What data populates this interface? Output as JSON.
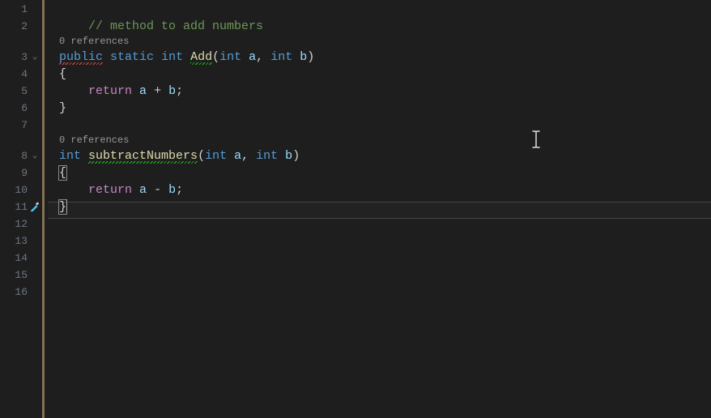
{
  "gutter": {
    "lines": [
      "1",
      "2",
      "3",
      "4",
      "5",
      "6",
      "7",
      "8",
      "9",
      "10",
      "11",
      "12",
      "13",
      "14",
      "15",
      "16"
    ]
  },
  "codelens": {
    "ref1": "0 references",
    "ref2": "0 references"
  },
  "code": {
    "l2_comment": "// method to add numbers",
    "l3_public": "public",
    "l3_static": "static",
    "l3_int": "int",
    "l3_method": "Add",
    "l3_p1t": "int",
    "l3_p1n": "a",
    "l3_p2t": "int",
    "l3_p2n": "b",
    "l4_brace": "{",
    "l5_return": "return",
    "l5_a": "a",
    "l5_op": "+",
    "l5_b": "b",
    "l5_semi": ";",
    "l6_brace": "}",
    "l8_int": "int",
    "l8_method": "subtractNumbers",
    "l8_p1t": "int",
    "l8_p1n": "a",
    "l8_p2t": "int",
    "l8_p2n": "b",
    "l9_brace": "{",
    "l10_return": "return",
    "l10_a": "a",
    "l10_op": "-",
    "l10_b": "b",
    "l10_semi": ";",
    "l11_brace": "}"
  }
}
